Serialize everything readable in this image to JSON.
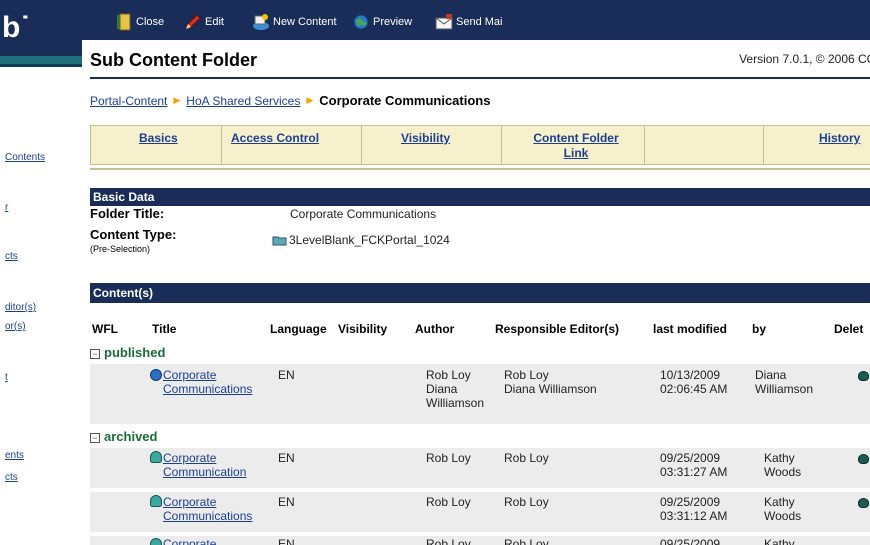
{
  "sidebar": {
    "logo": "b˙",
    "items": [
      "Contents",
      "r",
      "cts",
      "ditor(s)",
      "or(s)",
      "t",
      "ents",
      "cts"
    ]
  },
  "toolbar": {
    "close": "Close",
    "edit": "Edit",
    "new_content": "New Content",
    "preview": "Preview",
    "send_mail": "Send Mai"
  },
  "page": {
    "title": "Sub Content Folder",
    "version": "Version 7.0.1, © 2006 CO"
  },
  "breadcrumb": {
    "items": [
      "Portal-Content",
      "HoA Shared Services"
    ],
    "current": "Corporate Communications"
  },
  "tabs": {
    "basics": "Basics",
    "access_control": "Access Control",
    "visibility": "Visibility",
    "content_folder_link_1": "Content Folder",
    "content_folder_link_2": "Link",
    "history": "History"
  },
  "basic_data": {
    "header": "Basic Data",
    "folder_title_label": "Folder Title:",
    "folder_title_value": "Corporate Communications",
    "content_type_label": "Content Type:",
    "content_type_sub": "(Pre-Selection)",
    "content_type_value": "3LevelBlank_FCKPortal_1024"
  },
  "contents": {
    "header": "Content(s)",
    "columns": {
      "wfl": "WFL",
      "title": "Title",
      "language": "Language",
      "visibility": "Visibility",
      "author": "Author",
      "responsible_editors": "Responsible Editor(s)",
      "last_modified": "last modified",
      "by": "by",
      "delete": "Delet"
    },
    "groups": {
      "published": "published",
      "archived": "archived"
    },
    "published_rows": [
      {
        "title1": "Corporate",
        "title2": "Communications",
        "language": "EN",
        "author1": "Rob Loy",
        "author2": "Diana",
        "author3": "Williamson",
        "editor1": "Rob Loy",
        "editor2": "Diana Williamson",
        "date": "10/13/2009",
        "time": "02:06:45 AM",
        "by1": "Diana",
        "by2": "Williamson"
      }
    ],
    "archived_rows": [
      {
        "title1": "Corporate",
        "title2": "Communication",
        "language": "EN",
        "author": "Rob Loy",
        "editor": "Rob Loy",
        "date": "09/25/2009",
        "time": "03:31:27 AM",
        "by1": "Kathy",
        "by2": "Woods"
      },
      {
        "title1": "Corporate",
        "title2": "Communications",
        "language": "EN",
        "author": "Rob Loy",
        "editor": "Rob Loy",
        "date": "09/25/2009",
        "time": "03:31:12 AM",
        "by1": "Kathy",
        "by2": "Woods"
      },
      {
        "title1": "Corporate",
        "title2": "",
        "language": "EN",
        "author": "Rob Loy",
        "editor": "Rob Loy",
        "date": "09/25/2009",
        "time": "",
        "by1": "Kathy",
        "by2": ""
      }
    ]
  }
}
